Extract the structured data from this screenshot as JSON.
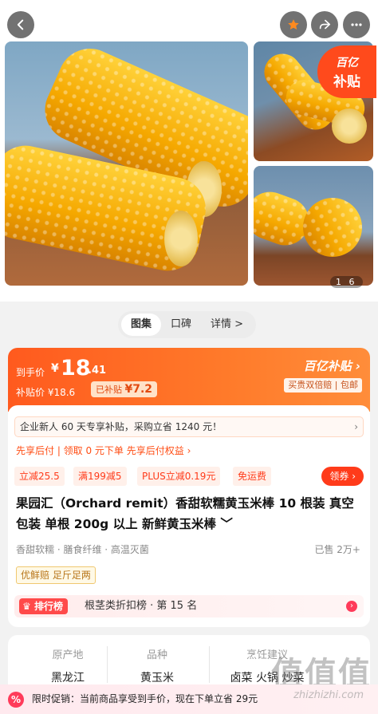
{
  "gallery": {
    "page_indicator": "1  6"
  },
  "badge": {
    "line1": "百亿",
    "line2": "补贴"
  },
  "tabs": [
    {
      "label": "图集",
      "active": true
    },
    {
      "label": "口碑",
      "active": false
    },
    {
      "label": "详情 >",
      "active": false
    }
  ],
  "price": {
    "label": "到手价",
    "currency": "¥",
    "integer": "18",
    "decimal": ".41",
    "subsidy_line": "补贴价 ¥18.6",
    "chip_prefix": "已补贴 ",
    "chip_value": "¥7.2",
    "logo": "百亿补贴 ›",
    "tag": "买贵双倍赔 | 包邮"
  },
  "card": {
    "promo_text": "企业新人 60 天专享补贴，采购立省 1240 元！",
    "bnpl": "先享后付 | 领取 0 元下单  先享后付权益 ›",
    "coupons": [
      "立减25.5",
      "满199减5",
      "PLUS立减0.19元",
      "免运费"
    ],
    "claim": "领券 ›",
    "title": "果园汇（Orchard remit）香甜软糯黄玉米棒 10 根装 真空包装 单根 200g 以上 新鲜黄玉米棒 ﹀",
    "attrs": "香甜软糯 · 膳食纤维 · 高温灭菌",
    "sold": "已售 2万+",
    "tag": "优鲜赔  足斤足两",
    "rank_badge": "排行榜",
    "rank_text": "根茎类折扣榜 · 第 15 名"
  },
  "spec": [
    {
      "key": "原产地",
      "value": "黑龙江"
    },
    {
      "key": "品种",
      "value": "黄玉米"
    },
    {
      "key": "烹饪建议",
      "value": "卤菜 火锅 炒菜"
    }
  ],
  "notice": {
    "icon": "%",
    "text": "限时促销：当前商品享受到手价，现在下单立省 29元"
  },
  "watermark": {
    "text": "值值值",
    "url": "zhizhizhi.com"
  },
  "colors": {
    "accent": "#ff4d14",
    "rank": "#ff4a4a"
  }
}
